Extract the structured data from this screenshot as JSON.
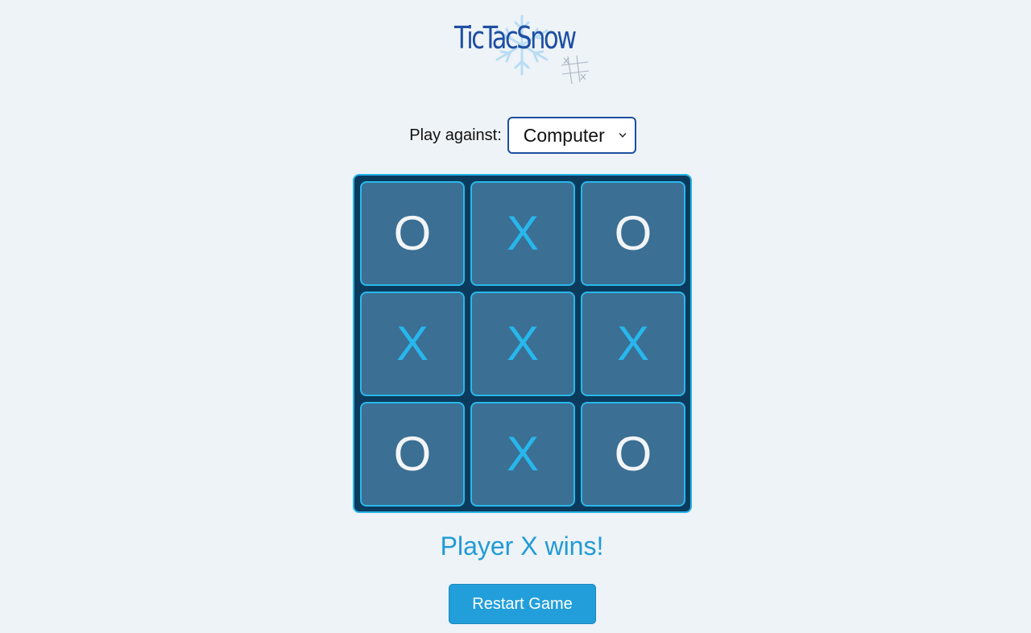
{
  "header": {
    "logo_text": "TicTacSnow"
  },
  "controls": {
    "label": "Play against:",
    "opponent_selected": "Computer"
  },
  "board": {
    "cells": [
      "O",
      "X",
      "O",
      "X",
      "X",
      "X",
      "O",
      "X",
      "O"
    ]
  },
  "status": {
    "message": "Player X wins!"
  },
  "actions": {
    "restart_label": "Restart Game"
  },
  "colors": {
    "background": "#eef3f7",
    "board_bg": "#0a3a5c",
    "cell_bg": "#3b6f94",
    "cell_border": "#2ab8ea",
    "x_color": "#27b7ec",
    "o_color": "#f2f4f6",
    "status_color": "#209bd6",
    "button_bg": "#229fdb",
    "logo_color": "#1e4fa3"
  },
  "icons": {
    "logo_decor": [
      "snowflake-icon",
      "tic-tac-toe-grid-icon"
    ],
    "select": "chevron-down-icon"
  }
}
